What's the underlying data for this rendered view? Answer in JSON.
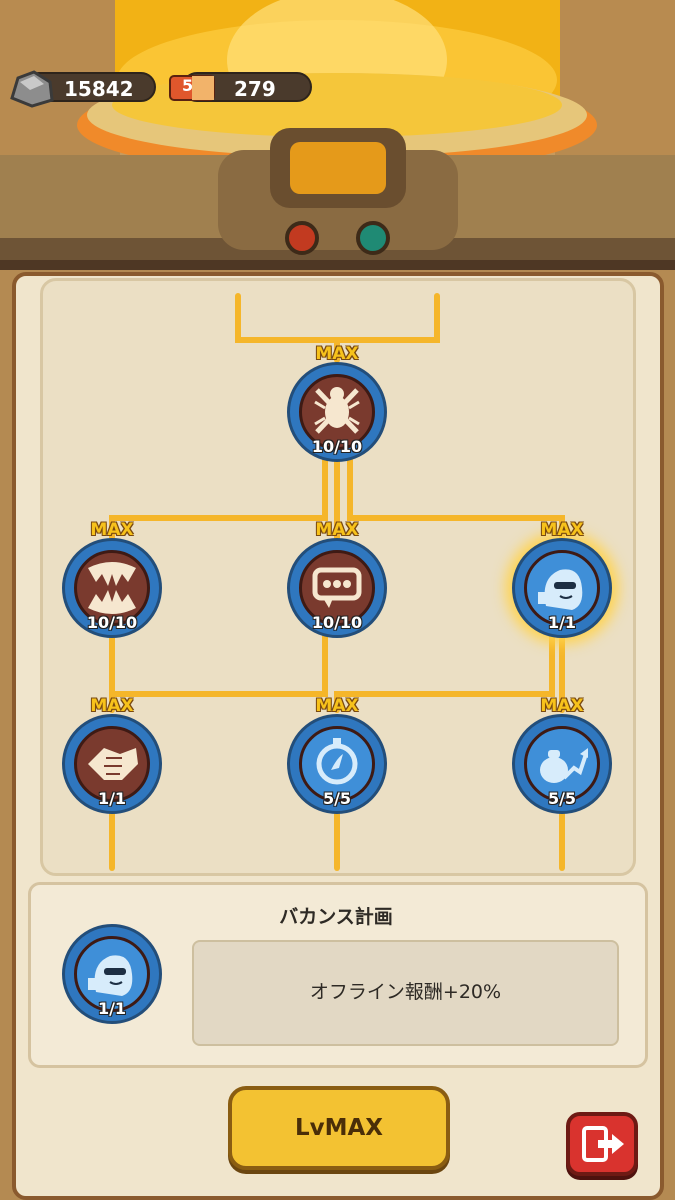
{
  "resources": {
    "stone": {
      "icon": "ore-stone-icon",
      "value": "15842"
    },
    "ticket": {
      "icon": "5min-ticket-icon",
      "value": "279",
      "badge": "5"
    }
  },
  "tree": {
    "max_label": "MAX",
    "nodes": [
      {
        "id": "insect-ban",
        "icon": "crossed-bug-icon",
        "level": "10/10",
        "max": true
      },
      {
        "id": "fangs",
        "icon": "fangs-icon",
        "level": "10/10",
        "max": true
      },
      {
        "id": "chat",
        "icon": "chat-bubble-icon",
        "level": "10/10",
        "max": true
      },
      {
        "id": "vacation",
        "icon": "vacation-blob-icon",
        "level": "1/1",
        "max": true,
        "selected": true
      },
      {
        "id": "handshake",
        "icon": "handshake-icon",
        "level": "1/1",
        "max": true
      },
      {
        "id": "stopwatch",
        "icon": "stopwatch-icon",
        "level": "5/5",
        "max": true
      },
      {
        "id": "money-up",
        "icon": "money-bag-up-icon",
        "level": "5/5",
        "max": true
      }
    ]
  },
  "detail": {
    "title": "バカンス計画",
    "icon": "vacation-blob-icon",
    "level": "1/1",
    "description": "オフライン報酬+20%"
  },
  "actions": {
    "upgrade_label": "LvMAX",
    "exit_icon": "exit-door-icon"
  },
  "colors": {
    "accent": "#f3c232",
    "line": "#f5b62a",
    "ring": "#2f77bf",
    "exit": "#d9332e"
  }
}
